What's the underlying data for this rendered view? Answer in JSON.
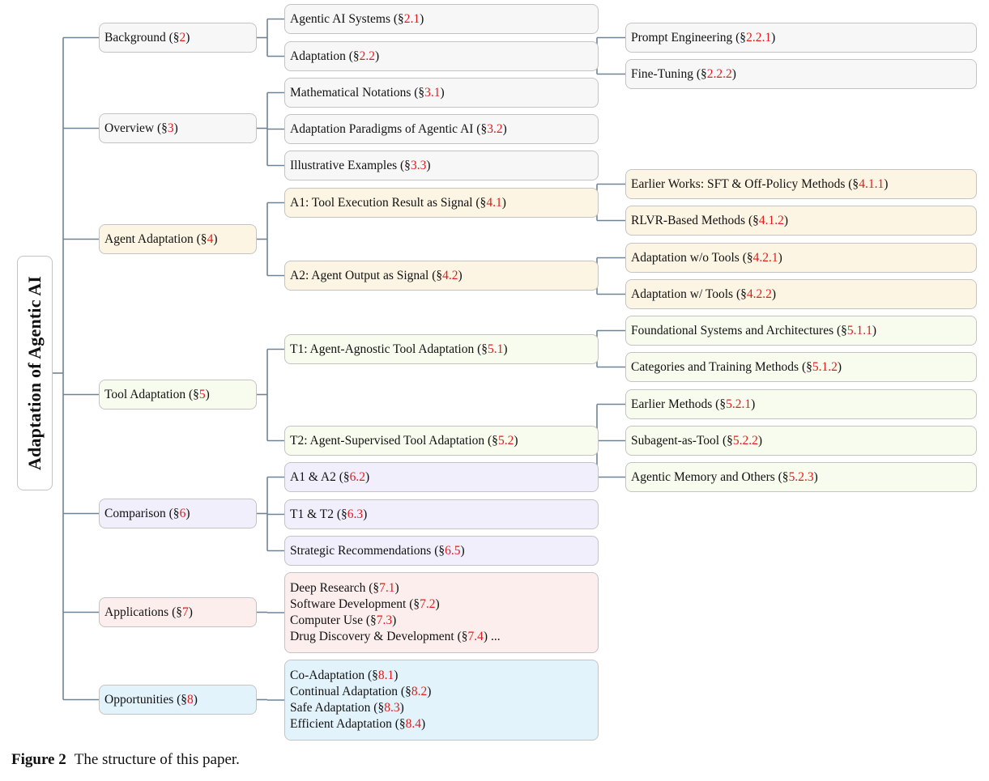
{
  "root": {
    "label": "Adaptation of Agentic AI"
  },
  "sections": [
    {
      "id": "bg",
      "label": "Background (§",
      "ref": "2",
      "end": ")",
      "color": "gray",
      "children": [
        {
          "id": "bg1",
          "label": "Agentic AI Systems (§",
          "ref": "2.1",
          "end": ")"
        },
        {
          "id": "bg2",
          "label": "Adaptation (§",
          "ref": "2.2",
          "end": ")",
          "children": [
            {
              "id": "bg2a",
              "label": "Prompt Engineering (§",
              "ref": "2.2.1",
              "end": ")"
            },
            {
              "id": "bg2b",
              "label": "Fine-Tuning (§",
              "ref": "2.2.2",
              "end": ")"
            }
          ]
        }
      ]
    },
    {
      "id": "ov",
      "label": "Overview (§",
      "ref": "3",
      "end": ")",
      "color": "gray",
      "children": [
        {
          "id": "ov1",
          "label": "Mathematical Notations (§",
          "ref": "3.1",
          "end": ")"
        },
        {
          "id": "ov2",
          "label": "Adaptation Paradigms of Agentic AI (§",
          "ref": "3.2",
          "end": ")"
        },
        {
          "id": "ov3",
          "label": "Illustrative Examples (§",
          "ref": "3.3",
          "end": ")"
        }
      ]
    },
    {
      "id": "aa",
      "label": "Agent Adaptation (§",
      "ref": "4",
      "end": ")",
      "color": "yellow",
      "children": [
        {
          "id": "aa1",
          "label": "A1:  Tool Execution Result as Signal (§",
          "ref": "4.1",
          "end": ")",
          "children": [
            {
              "id": "aa1a",
              "label": "Earlier Works:  SFT & Off-Policy Methods (§",
              "ref": "4.1.1",
              "end": ")"
            },
            {
              "id": "aa1b",
              "label": "RLVR-Based Methods (§",
              "ref": "4.1.2",
              "end": ")"
            }
          ]
        },
        {
          "id": "aa2",
          "label": "A2:  Agent Output as Signal (§",
          "ref": "4.2",
          "end": ")",
          "children": [
            {
              "id": "aa2a",
              "label": "Adaptation w/o Tools (§",
              "ref": "4.2.1",
              "end": ")"
            },
            {
              "id": "aa2b",
              "label": "Adaptation w/ Tools (§",
              "ref": "4.2.2",
              "end": ")"
            }
          ]
        }
      ]
    },
    {
      "id": "ta",
      "label": "Tool Adaptation (§",
      "ref": "5",
      "end": ")",
      "color": "green",
      "children": [
        {
          "id": "ta1",
          "label": "T1:  Agent-Agnostic Tool Adaptation (§",
          "ref": "5.1",
          "end": ")",
          "children": [
            {
              "id": "ta1a",
              "label": "Foundational Systems and Architectures (§",
              "ref": "5.1.1",
              "end": ")"
            },
            {
              "id": "ta1b",
              "label": "Categories and Training Methods (§",
              "ref": "5.1.2",
              "end": ")"
            }
          ]
        },
        {
          "id": "ta2",
          "label": "T2:  Agent-Supervised Tool Adaptation (§",
          "ref": "5.2",
          "end": ")",
          "children": [
            {
              "id": "ta2a",
              "label": "Earlier Methods (§",
              "ref": "5.2.1",
              "end": ")"
            },
            {
              "id": "ta2b",
              "label": "Subagent-as-Tool (§",
              "ref": "5.2.2",
              "end": ")"
            },
            {
              "id": "ta2c",
              "label": "Agentic Memory and Others (§",
              "ref": "5.2.3",
              "end": ")"
            }
          ]
        }
      ]
    },
    {
      "id": "cm",
      "label": "Comparison (§",
      "ref": "6",
      "end": ")",
      "color": "purple",
      "children": [
        {
          "id": "cm1",
          "label": "A1 & A2 (§",
          "ref": "6.2",
          "end": ")"
        },
        {
          "id": "cm2",
          "label": "T1 & T2 (§",
          "ref": "6.3",
          "end": ")"
        },
        {
          "id": "cm3",
          "label": "Strategic Recommendations (§",
          "ref": "6.5",
          "end": ")"
        }
      ]
    },
    {
      "id": "ap",
      "label": "Applications (§",
      "ref": "7",
      "end": ")",
      "color": "pink",
      "children": [
        {
          "id": "ap1",
          "lines": [
            {
              "label": "Deep Research (§",
              "ref": "7.1",
              "end": ")"
            },
            {
              "label": "Software Development (§",
              "ref": "7.2",
              "end": ")"
            },
            {
              "label": "Computer Use (§",
              "ref": "7.3",
              "end": ")"
            },
            {
              "label": "Drug Discovery & Development (§",
              "ref": "7.4",
              "end": ") ..."
            }
          ]
        }
      ]
    },
    {
      "id": "op",
      "label": "Opportunities (§",
      "ref": "8",
      "end": ")",
      "color": "blue",
      "children": [
        {
          "id": "op1",
          "lines": [
            {
              "label": "Co-Adaptation (§",
              "ref": "8.1",
              "end": ")"
            },
            {
              "label": "Continual Adaptation (§",
              "ref": "8.2",
              "end": ")"
            },
            {
              "label": "Safe Adaptation (§",
              "ref": "8.3",
              "end": ")"
            },
            {
              "label": "Efficient Adaptation (§",
              "ref": "8.4",
              "end": ")"
            }
          ]
        }
      ]
    }
  ],
  "caption": {
    "figure": "Figure 2",
    "text": "The structure of this paper."
  }
}
